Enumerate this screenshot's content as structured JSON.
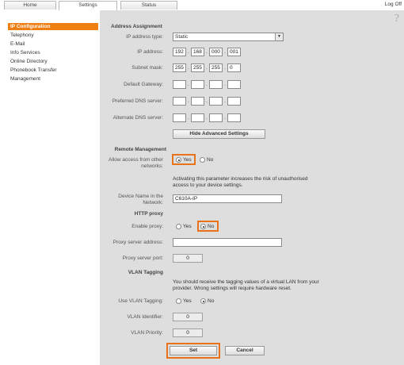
{
  "tabs": {
    "home": "Home",
    "settings": "Settings",
    "status": "Status",
    "logoff": "Log Off"
  },
  "sidebar": {
    "items": [
      "IP Configuration",
      "Telephony",
      "E-Mail",
      "Info Services",
      "Online Directory",
      "Phonebook Transfer",
      "Management"
    ]
  },
  "help_glyph": "?",
  "address": {
    "header": "Address Assignment",
    "ip_type_label": "IP address type:",
    "ip_type_value": "Static",
    "ip_label": "IP address:",
    "ip": [
      "192",
      "168",
      "000",
      "001"
    ],
    "subnet_label": "Subnet mask:",
    "subnet": [
      "255",
      "255",
      "255",
      "0"
    ],
    "gateway_label": "Default Gateway:",
    "pref_dns_label": "Preferred DNS server:",
    "alt_dns_label": "Alternate DNS server:",
    "hide_adv": "Hide Advanced Settings"
  },
  "remote": {
    "header": "Remote Management",
    "allow_label_1": "Allow access from other",
    "allow_label_2": "networks:",
    "yes": "Yes",
    "no": "No",
    "note_1": "Activating this parameter increases the risk of unauthorised",
    "note_2": "access to your device settings.",
    "device_label_1": "Device Name in the",
    "device_label_2": "Network:",
    "device_value": "C610A-IP"
  },
  "proxy": {
    "header": "HTTP proxy",
    "enable_label": "Enable proxy:",
    "yes": "Yes",
    "no": "No",
    "addr_label": "Proxy server address:",
    "port_label": "Proxy server port:",
    "port_value": "0"
  },
  "vlan": {
    "header": "VLAN Tagging",
    "note_1": "You should receive the tagging values of a virtual LAN from your",
    "note_2": "provider. Wrong settings will require hardware reset.",
    "use_label": "Use VLAN Tagging:",
    "yes": "Yes",
    "no": "No",
    "id_label": "VLAN Identifier:",
    "id_value": "0",
    "prio_label": "VLAN Priority:",
    "prio_value": "0"
  },
  "actions": {
    "set": "Set",
    "cancel": "Cancel"
  },
  "colors": {
    "accent": "#f07f13",
    "highlight": "#e8731a",
    "panel": "#dedede"
  }
}
